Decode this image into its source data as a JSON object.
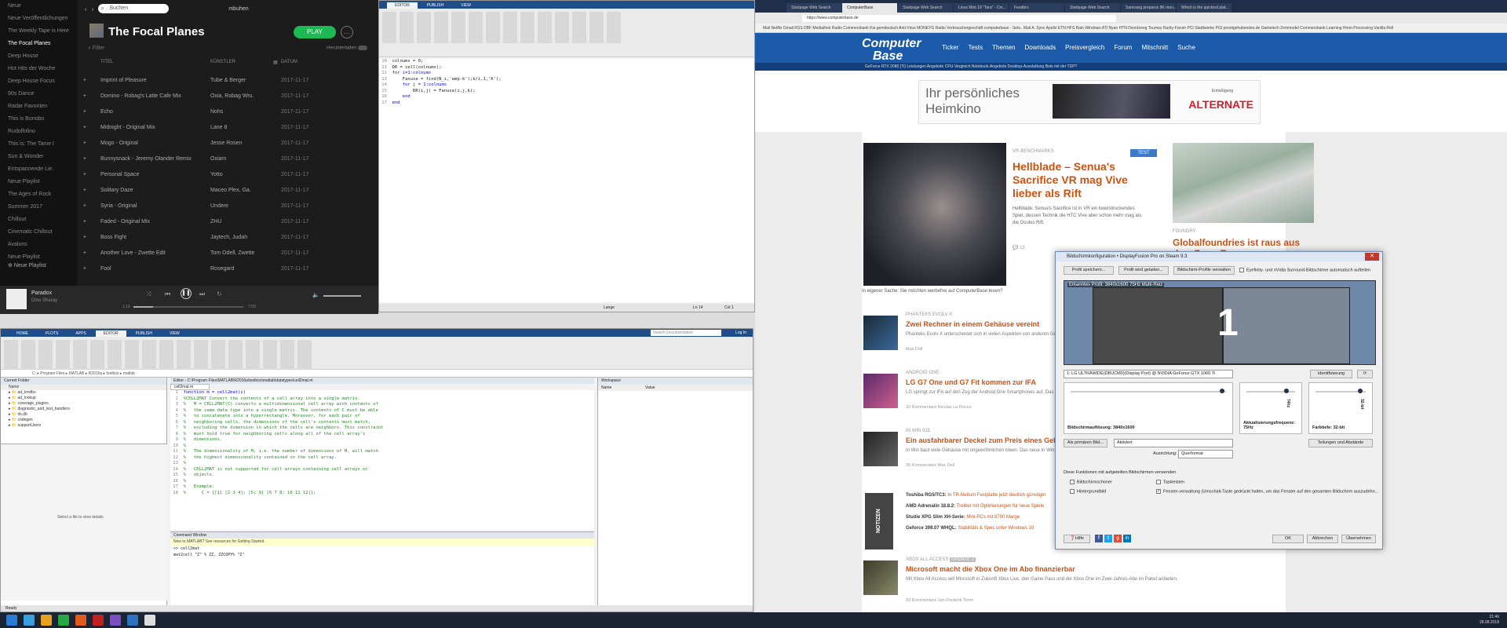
{
  "spotify": {
    "search_placeholder": "Suchen",
    "user": "mbuhen",
    "sidebar": [
      "Neue",
      "Neue Veröffentlichungen",
      "The Weekly Tape is Here",
      "The Focal Planes",
      "Deep House",
      "Hot Hits der Woche",
      "Deep House Focus",
      "90s Dance",
      "Radar Favoriten",
      "This is Bonobo",
      "Rudolfolino",
      "This is: The Tame I",
      "Sun & Wonder",
      "Entspannende Lie.",
      "Neue Playlist",
      "The Ages of Rock",
      "Summer 2017",
      "Chillout",
      "Cinematic Chillout",
      "Avalons",
      "Neue Playlist"
    ],
    "active_index": 3,
    "playlist_title": "The Focal Planes",
    "play_label": "PLAY",
    "filter_placeholder": "Filter",
    "download_label": "Herunterladen",
    "columns": [
      "TITEL",
      "KÜNSTLER",
      "",
      "DATUM"
    ],
    "tracks": [
      {
        "title": "Imprint of Pleasure",
        "artist": "Tube & Berger",
        "date": "2017-11-17"
      },
      {
        "title": "Domino - Robag's Latte Cafe Mix",
        "artist": "Oxia, Robag Wru.",
        "date": "2017-11-17"
      },
      {
        "title": "Echo",
        "artist": "Nohs",
        "date": "2017-11-17"
      },
      {
        "title": "Midnight - Original Mix",
        "artist": "Lane 8",
        "date": "2017-11-17"
      },
      {
        "title": "Mogo - Original",
        "artist": "Jesse Rosen",
        "date": "2017-11-17"
      },
      {
        "title": "Bunnysnack - Jeremy Olander Remix",
        "artist": "Oxiam",
        "date": "2017-11-17"
      },
      {
        "title": "Personal Space",
        "artist": "Yotto",
        "date": "2017-11-17"
      },
      {
        "title": "Solitary Daze",
        "artist": "Maceo Plex, Ga.",
        "date": "2017-11-17"
      },
      {
        "title": "Syria - Original",
        "artist": "Undere",
        "date": "2017-11-17"
      },
      {
        "title": "Faded - Original Mix",
        "artist": "ZHU",
        "date": "2017-11-17"
      },
      {
        "title": "Boss Fight",
        "artist": "Jaytech, Judah",
        "date": "2017-11-17"
      },
      {
        "title": "Another Love - Zwette Edit",
        "artist": "Tom Odell, Zwette",
        "date": "2017-11-17"
      },
      {
        "title": "Fool",
        "artist": "Rosegard",
        "date": "2017-11-17"
      }
    ],
    "new_playlist": "Neue Playlist",
    "now_playing": "Paradox",
    "now_playing_sub": "Dino Sharay",
    "time_left": "1:16",
    "time_right": "7:03"
  },
  "matlab_top": {
    "tabs": [
      "EDITOR",
      "PUBLISH",
      "VIEW"
    ],
    "code": [
      [
        "10",
        "colnums = 0;"
      ],
      [
        "11",
        "DR = cell(colnums);"
      ],
      [
        "12",
        "for i=1:colnums"
      ],
      [
        "13",
        "    Fanuse = find(N_i,'emp-k');k/i,1,'K');"
      ],
      [
        "14",
        "    for j = 1:colnums"
      ],
      [
        "15",
        "        DR(i,j) = Fanuse(i,j,k);"
      ],
      [
        "16",
        "    end"
      ],
      [
        "17",
        "end"
      ]
    ],
    "status_left": "Lange",
    "status_mid": "Ln 14",
    "status_right": "Col 1"
  },
  "matlab_bottom": {
    "tabs": [
      "HOME",
      "PLOTS",
      "APPS",
      "EDITOR",
      "PUBLISH",
      "VIEW"
    ],
    "search": "Search Documentation",
    "login": "Log In",
    "address": "C: ▸ Program Files ▸ MATLAB ▸ R2016a ▸ toolbox ▸ matlab",
    "editor_path": "Editor - C:\\Program Files\\MATLAB\\R2016a\\toolbox\\matlab\\datatypes\\cell2mat.m",
    "current_folder": "Current Folder",
    "folder_col": "Name",
    "folders": [
      "ad_kmdbx",
      "ad_lookup",
      "coverage_plugins",
      "diagnostic_and_test_handlers",
      "ds.db",
      "codegen",
      "supportUsers"
    ],
    "details": "Select a file to view details",
    "file_tab": "cell2mat.m",
    "code": [
      [
        "1",
        "function m = cell2mat(c)"
      ],
      [
        "2",
        "%CELL2MAT Convert the contents of a cell array into a single matrix."
      ],
      [
        "3",
        "%   M = CELL2MAT(C) converts a multidimensional cell array with contents of"
      ],
      [
        "4",
        "%   the same data type into a single matrix. The contents of C must be able"
      ],
      [
        "5",
        "%   to concatenate into a hyperrectangle. Moreover, for each pair of"
      ],
      [
        "6",
        "%   neighboring cells, the dimensions of the cell's contents must match,"
      ],
      [
        "7",
        "%   excluding the dimension in which the cells are neighbors. This constraint"
      ],
      [
        "8",
        "%   must hold true for neighboring cells along all of the cell array's"
      ],
      [
        "9",
        "%   dimensions."
      ],
      [
        "10",
        "%"
      ],
      [
        "11",
        "%   The dimensionality of M, i.e. the number of dimensions of M, will match"
      ],
      [
        "12",
        "%   the highest dimensionality contained in the cell array."
      ],
      [
        "13",
        "%"
      ],
      [
        "14",
        "%   CELL2MAT is not supported for cell arrays containing cell arrays or"
      ],
      [
        "15",
        "%   objects."
      ],
      [
        "16",
        "%"
      ],
      [
        "17",
        "%   Example:"
      ],
      [
        "18",
        "%      C = {[1] [2 3 4]; [5; 9] [6 7 8; 10 11 12]};"
      ]
    ],
    "command_window": "Command Window",
    "warning": "New to MATLAB? See resources for Getting Started.",
    "cmd": [
      ">> cell2mat",
      "  mat2cell \"Z\" % ZZ, ZZCOPY% \"Z\""
    ],
    "workspace": "Workspace",
    "ws_cols": [
      "Name",
      "Value"
    ],
    "status": "Ready"
  },
  "browser": {
    "tabs": [
      "Startpage Web Search",
      "ComputerBase",
      "Startpage Web Search",
      "Linux Mint 19 \"Tara\" - Cin...",
      "Feedbro",
      "Startpage Web Search",
      "Samsung prepares 8K mon...",
      "Which is the quickest plat..."
    ],
    "active_tab": 1,
    "url": "https://www.computerbase.de",
    "bookmarks": "Mail   Netflix   Gmail   RSS   DBF   Mediathek   Radio Commerzbank   Kia   gemdeutsch   Anti-Virus   MONEYG   Radio Verbrauchergeschäft   computerbase - Sets..   Mail A.   Sync   Apollo   ETN   HFS   Rain Windows   ATI   Nyan HTN Dsnnbrsng   Tourney   Rarity-Forum   PCI   Stadtwerke   PGI   prestigehabendes.de   Gametech   Zemmodel Commerzbank   Learning Hmm   Processing Vanilla Roll"
  },
  "computerbase": {
    "logo_1": "Computer",
    "logo_2": "Base",
    "nav": [
      "Ticker",
      "Tests",
      "Themen",
      "Downloads",
      "Preisvergleich",
      "Forum",
      "Mitschnitt",
      "Suche"
    ],
    "subnav": "GeForce RTX 2080 (Ti)   Leistungen Angebote   CPU-Vergleich   Notebook-Angebote   Desktop-Ausstattung   Bots mit der TDP?",
    "ad_text": "Ihr persönliches Heimkino",
    "ad_brand": "ALTERNATE",
    "ad_small": "Ermäßigung",
    "hero": {
      "tag": "VR-BENCHMARKS",
      "badge": "TEST",
      "title": "Hellblade – Senua's Sacrifice VR mag Vive lieber als Rift",
      "text": "Hellblade: Senua's Sacrifice ist in VR ein beeindruckendes Spiel, dessen Technik die HTC Vive aber schon mehr mag als die Oculus Rift.",
      "meta": "12"
    },
    "side": {
      "tag": "FOUNDRY",
      "title": "Globalfoundries ist raus aus dem 7-nm-Rennen"
    },
    "intro": "In eigener Sache: Sie möchten werbefrei auf ComputerBase lesen?",
    "articles": [
      {
        "tag": "PHANTEKS EVOLV X",
        "title": "Zwei Rechner in einem Gehäuse vereint",
        "text": "Phanteks Evolv X unterscheidet sich in vielen Aspekten von anderen Gehäusen. Unter anderem können in diesem Gehäuse gleich zwei Rechner parallel aufgenommen werden.",
        "meta": "Max Doll"
      },
      {
        "tag": "ANDROID ONE",
        "title": "LG G7 One und G7 Fit kommen zur IFA",
        "text": "LG springt zur IFA auf den Zug der Android One Smartphones auf. Das G7 One und G7 Fit sind nur wenige Änderungen.",
        "meta": "33 Kommentare   Nicolas La Rocco"
      },
      {
        "tag": "IN WIN 915",
        "title": "Ein ausfahrbarer Deckel zum Preis eines Gehäuses",
        "text": "In Win baut viele Gehäuse mit ungewöhnlichen Ideen. Das neue In Win 915 setzt auf einen ausfahrbaren Deckel. Das 915 ist keine Ausnahme.",
        "meta": "35 Kommentare   Max Doll"
      }
    ],
    "news_label": "NOTIZEN",
    "news": [
      {
        "bold": "Toshiba RG5/TC3:",
        "rest": "In TR-Nettum Festplatte jetzt deutlich günstiger"
      },
      {
        "bold": "AMD Adrenalin 18.8.2:",
        "rest": "Treiber mit Optimierungen für neue Spiele"
      },
      {
        "bold": "Studie XPG Slim XH-Serie:",
        "rest": "Mini-PCs mit 8700 Marge"
      },
      {
        "bold": "Geforce 399.07 WHQL:",
        "rest": "Stabilitäts & Spec unter Windows 10"
      }
    ],
    "bottom_article": {
      "tag": "XBOX ALL ACCESS",
      "badge": "UPDATE 2",
      "title": "Microsoft macht die Xbox One im Abo finanzierbar",
      "text": "Mit Xbox All Access will Microsoft in Zukunft Xbox Live, den Game Pass und die Xbox One im Zwei-Jahres-Abo im Paket anbieten.",
      "meta": "93 Kommentare   Jan-Frederik Timm"
    }
  },
  "dialog": {
    "title": "Bildschirmkonfiguration • DisplayFusion Pro on Steam 9.3",
    "btn_profile_save": "Profil speichern...",
    "btn_profile_load": "Profil wird geladen...",
    "btn_profile_manage": "Bildschirm-Profile verwalten",
    "chk_eyefinity": "Eyefinity- und nVidia Surround-Bildschirme automatisch aufteilen",
    "preview_label": "Erkanntes Profil: 3840x1600 75Hz Multi-Reiz",
    "monitor_number": "1",
    "monitor_select": "1: LG ULTRAWIDE(DBUCM0)(Display Port) @ NVIDIA GeForce GTX 1060 Ti",
    "identify_btn": "Identifizierung",
    "resolution_label": "Bildschirmauflösung: 3840x1600",
    "refresh_label": "Aktualisierungsfrequenz: 75Hz",
    "color_label": "Farbtiefe: 32-bit",
    "refresh_value": "74hz",
    "color_value": "32-bit",
    "primary_btn": "Als primären Bild...",
    "active_select": "Aktiviert",
    "splits_btn": "Teilungen und Abstände",
    "orientation_label": "Ausrichtung:",
    "orientation_select": "Querformat",
    "disable_label": "Diese Funktionen mit aufgeteilten Bildschirmen verwenden",
    "opt_screensaver": "Bildschirmschoner",
    "opt_taskbars": "Taskleisten",
    "opt_wallpaper": "Hintergrundbild",
    "opt_windowmgmt": "Fenster-verwaltung (Umschalt-Taste gedrückt halten, um das Fenster auf den gesamten Bildschirm auszudehn...",
    "help_btn": "Hilfe",
    "ok": "OK",
    "cancel": "Abbrechen",
    "apply": "Übernehmen"
  },
  "taskbar": {
    "time": "21:46",
    "date": "28.08.2018"
  }
}
